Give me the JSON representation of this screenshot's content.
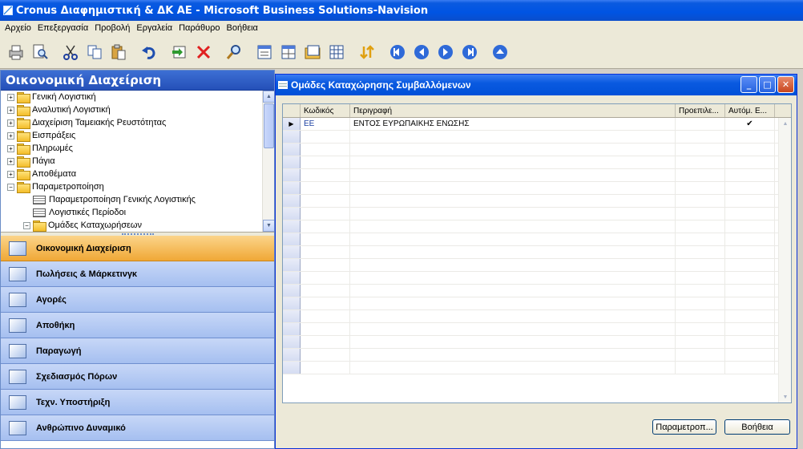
{
  "app": {
    "title": "Cronus Διαφημιστική & ΔΚ ΑΕ - Microsoft Business Solutions-Navision"
  },
  "menu": [
    "Αρχείο",
    "Επεξεργασία",
    "Προβολή",
    "Εργαλεία",
    "Παράθυρο",
    "Βοήθεια"
  ],
  "toolbar": {
    "icons": [
      "print-icon",
      "print-preview-icon",
      "cut-icon",
      "copy-icon",
      "paste-icon",
      "undo-icon",
      "insert-icon",
      "delete-icon",
      "find-icon",
      "form-icon",
      "list-icon",
      "card-icon",
      "table-icon",
      "sort-icon",
      "first-icon",
      "previous-icon",
      "next-icon",
      "last-icon",
      "up-icon"
    ]
  },
  "navpane": {
    "title": "Οικονομική Διαχείριση",
    "tree": [
      {
        "label": "Γενική Λογιστική",
        "type": "folder",
        "level": 0,
        "expander": "+"
      },
      {
        "label": "Αναλυτική Λογιστική",
        "type": "folder",
        "level": 0,
        "expander": "+"
      },
      {
        "label": "Διαχείριση Ταμειακής Ρευστότητας",
        "type": "folder",
        "level": 0,
        "expander": "+"
      },
      {
        "label": "Εισπράξεις",
        "type": "folder",
        "level": 0,
        "expander": "+"
      },
      {
        "label": "Πληρωμές",
        "type": "folder",
        "level": 0,
        "expander": "+"
      },
      {
        "label": "Πάγια",
        "type": "folder",
        "level": 0,
        "expander": "+"
      },
      {
        "label": "Αποθέματα",
        "type": "folder",
        "level": 0,
        "expander": "+"
      },
      {
        "label": "Παραμετροποίηση",
        "type": "folder",
        "level": 0,
        "expander": "−"
      },
      {
        "label": "Παραμετροποίηση Γενικής Λογιστικής",
        "type": "form",
        "level": 1,
        "expander": ""
      },
      {
        "label": "Λογιστικές Περίοδοι",
        "type": "form",
        "level": 1,
        "expander": ""
      },
      {
        "label": "Ομάδες Καταχωρήσεων",
        "type": "folder",
        "level": 1,
        "expander": "−"
      }
    ],
    "buttons": [
      {
        "label": "Οικονομική Διαχείριση",
        "active": true
      },
      {
        "label": "Πωλήσεις & Μάρκετινγκ",
        "active": false
      },
      {
        "label": "Αγορές",
        "active": false
      },
      {
        "label": "Αποθήκη",
        "active": false
      },
      {
        "label": "Παραγωγή",
        "active": false
      },
      {
        "label": "Σχεδιασμός Πόρων",
        "active": false
      },
      {
        "label": "Τεχν. Υποστήριξη",
        "active": false
      },
      {
        "label": "Ανθρώπινο Δυναμικό",
        "active": false
      }
    ]
  },
  "window": {
    "title": "Ομάδες Καταχώρησης Συμβαλλόμενων",
    "columns": [
      "",
      "Κωδικός",
      "Περιγραφή",
      "Προεπιλε...",
      "Αυτόμ. Ε..."
    ],
    "rows": [
      {
        "code": "ΕΕ",
        "description": "ΕΝΤΟΣ ΕΥΡΩΠΑΙΚΗΣ ΕΝΩΣΗΣ",
        "default": "",
        "auto": "✔"
      }
    ],
    "empty_rows": 19,
    "buttons": {
      "setup": "Παραμετροπ...",
      "help": "Βοήθεια"
    }
  }
}
